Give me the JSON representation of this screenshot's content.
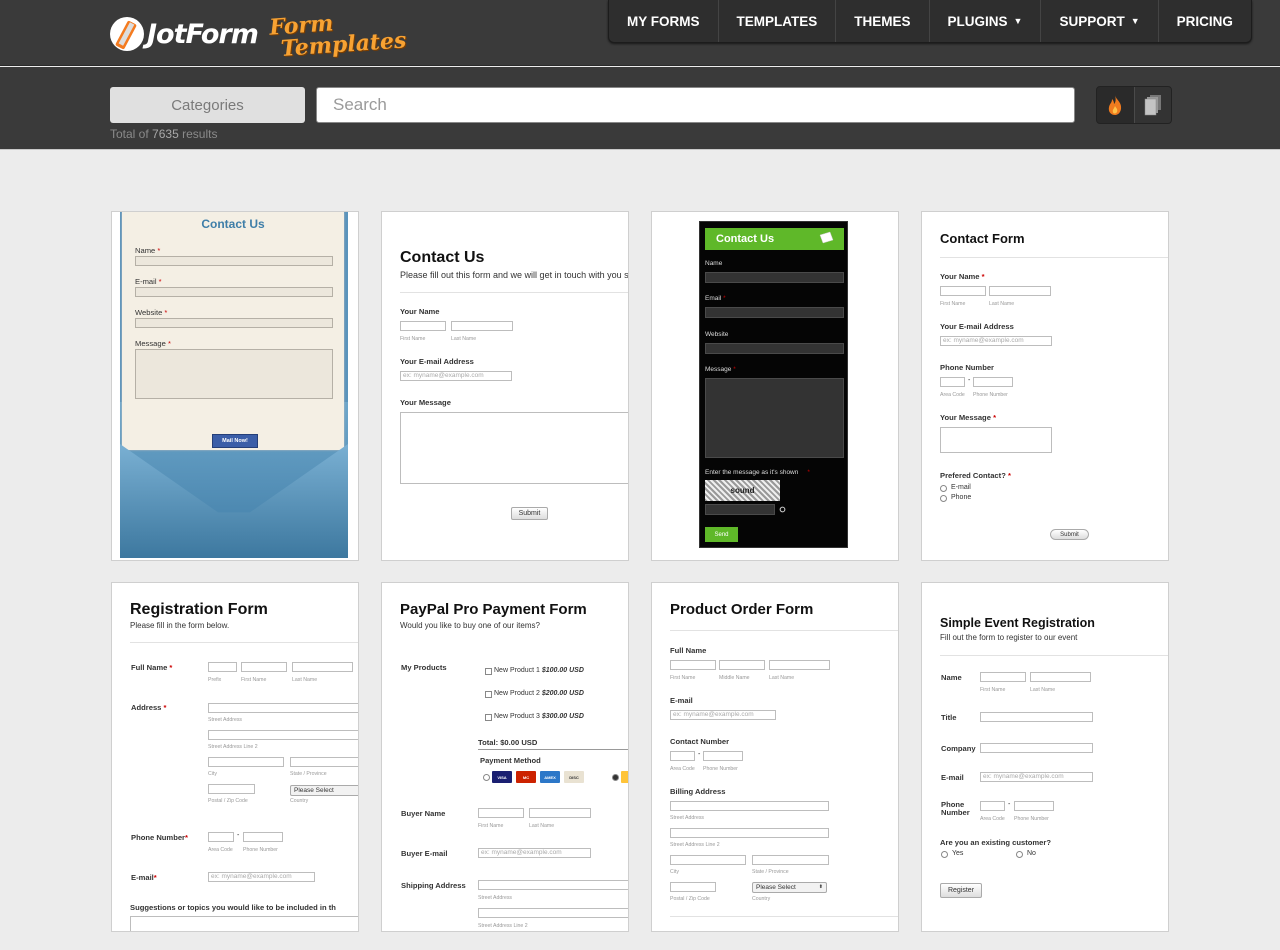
{
  "header": {
    "logo_text": "JotForm",
    "logo_sub_1": "Form",
    "logo_sub_2": "Templates",
    "nav": [
      {
        "label": "MY FORMS"
      },
      {
        "label": "TEMPLATES"
      },
      {
        "label": "THEMES"
      },
      {
        "label": "PLUGINS",
        "caret": "▼"
      },
      {
        "label": "SUPPORT",
        "caret": "▼"
      },
      {
        "label": "PRICING"
      }
    ]
  },
  "toolbar": {
    "categories_label": "Categories",
    "search_placeholder": "Search",
    "total_prefix": "Total of",
    "total_count": "7635",
    "total_suffix": "results",
    "view_icons": [
      "fire-icon",
      "stack-icon"
    ]
  },
  "colors": {
    "header_bg": "#3a3a3a",
    "page_bg": "#ececec",
    "accent_orange": "#f47b20",
    "green": "#5fb829",
    "blue_button": "#3b5ea8"
  },
  "templates": [
    {
      "title": "Contact Us",
      "fields": [
        "Name",
        "E-mail",
        "Website",
        "Message"
      ],
      "required": "*",
      "button": "Mail Now!"
    },
    {
      "title": "Contact Us",
      "subtitle": "Please fill out this form and we will get in touch with you shortl",
      "name_label": "Your Name",
      "first": "First Name",
      "last": "Last Name",
      "email_label": "Your E-mail Address",
      "email_ph": "ex: myname@example.com",
      "message_label": "Your Message",
      "button": "Submit"
    },
    {
      "title": "Contact Us",
      "fields": [
        "Name",
        "Email",
        "Website",
        "Message"
      ],
      "required": "*",
      "captcha_label": "Enter the message as it's shown",
      "captcha_word": "sound",
      "button": "Send"
    },
    {
      "title": "Contact Form",
      "name_label": "Your Name",
      "first": "First Name",
      "last": "Last Name",
      "email_label": "Your E-mail Address",
      "email_ph": "ex: myname@example.com",
      "phone_label": "Phone Number",
      "area": "Area Code",
      "phone": "Phone Number",
      "message_label": "Your Message",
      "contact_label": "Prefered Contact?",
      "options": [
        "E-mail",
        "Phone"
      ],
      "button": "Submit"
    },
    {
      "title": "Registration Form",
      "subtitle": "Please fill in the form below.",
      "full_name": "Full Name",
      "prefix": "Prefix",
      "first": "First Name",
      "last": "Last Name",
      "address": "Address",
      "street": "Street Address",
      "street2": "Street Address Line 2",
      "city": "City",
      "state": "State / Province",
      "postal": "Postal / Zip Code",
      "country_select": "Please Select",
      "country": "Country",
      "phone_label": "Phone Number",
      "area": "Area Code",
      "phone": "Phone Number",
      "email_label": "E-mail",
      "email_ph": "ex: myname@example.com",
      "suggestions": "Suggestions or topics you would like to be included in th"
    },
    {
      "title": "PayPal Pro Payment Form",
      "subtitle": "Would you like to buy one of our items?",
      "products_label": "My Products",
      "products": [
        {
          "name": "New Product 1",
          "price": "$100.00 USD"
        },
        {
          "name": "New Product 2",
          "price": "$200.00 USD"
        },
        {
          "name": "New Product 3",
          "price": "$300.00 USD"
        }
      ],
      "total": "Total: $0.00 USD",
      "payment_label": "Payment Method",
      "cards": [
        "VISA",
        "MC",
        "AMEX",
        "DISC"
      ],
      "buyer_name": "Buyer Name",
      "first": "First Name",
      "last": "Last Name",
      "buyer_email": "Buyer E-mail",
      "email_ph": "ex: myname@example.com",
      "shipping": "Shipping Address",
      "street": "Street Address",
      "street2": "Street Address Line 2"
    },
    {
      "title": "Product Order Form",
      "full_name": "Full Name",
      "first": "First Name",
      "middle": "Middle Name",
      "last": "Last Name",
      "email_label": "E-mail",
      "email_ph": "ex: myname@example.com",
      "contact_label": "Contact Number",
      "area": "Area Code",
      "phone": "Phone Number",
      "billing": "Billing Address",
      "street": "Street Address",
      "street2": "Street Address Line 2",
      "city": "City",
      "state": "State / Province",
      "postal": "Postal / Zip Code",
      "country_select": "Please Select",
      "country": "Country"
    },
    {
      "title": "Simple Event Registration",
      "subtitle": "Fill out the form to register to our event",
      "name_label": "Name",
      "first": "First Name",
      "last": "Last Name",
      "title_label": "Title",
      "company_label": "Company",
      "email_label": "E-mail",
      "email_ph": "ex: myname@example.com",
      "phone_label_1": "Phone",
      "phone_label_2": "Number",
      "area": "Area Code",
      "phone": "Phone Number",
      "existing": "Are you an existing customer?",
      "options": [
        "Yes",
        "No"
      ],
      "button": "Register"
    }
  ]
}
